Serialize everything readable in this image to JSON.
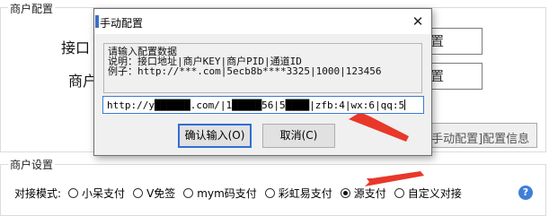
{
  "merchant_config": {
    "legend": "商户配置",
    "label_1": "接口",
    "label_2": "商户",
    "field_1_tail": "置",
    "field_2_tail": "置",
    "info_button_label": "[手动配置]配置信息"
  },
  "merchant_settings": {
    "legend": "商户设置",
    "mode_label": "对接模式:",
    "options": [
      "小呆支付",
      "V免签",
      "mym码支付",
      "彩虹易支付",
      "源支付",
      "自定义对接"
    ],
    "selected": "源支付",
    "help_icon": "?"
  },
  "dialog": {
    "title": "手动配置",
    "close_icon": "✕",
    "info_lines": [
      "请输入配置数据",
      "说明：接口地址|商户KEY|商户PID|通道ID",
      "例子：http://***.com|5ecb8b****3325|1000|123456"
    ],
    "input_value": "http://y██████.com/|1█████56|5████|zfb:4|wx:6|qq:5",
    "confirm_label": "确认输入(O)",
    "cancel_label": "取消(C)"
  },
  "annotation_color": "#e8382a"
}
